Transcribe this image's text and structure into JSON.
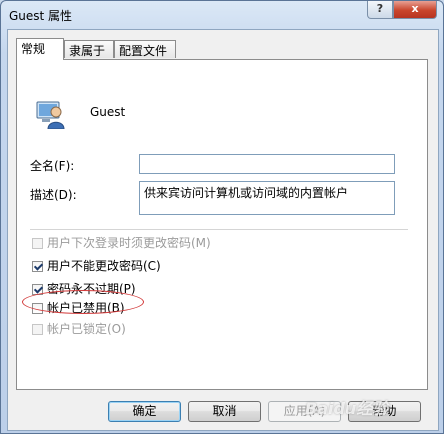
{
  "window": {
    "title": "Guest 属性",
    "help_label": "?",
    "close_label": "x"
  },
  "tabs": [
    {
      "label": "常规",
      "active": true
    },
    {
      "label": "隶属于",
      "active": false
    },
    {
      "label": "配置文件",
      "active": false
    }
  ],
  "user": {
    "name": "Guest",
    "icon": "user-icon"
  },
  "fields": {
    "fullname_label": "全名(F):",
    "fullname_value": "",
    "description_label": "描述(D):",
    "description_value": "供来宾访问计算机或访问域的内置帐户"
  },
  "checkboxes": [
    {
      "label": "用户下次登录时须更改密码(M)",
      "checked": false,
      "enabled": false
    },
    {
      "label": "用户不能更改密码(C)",
      "checked": true,
      "enabled": true
    },
    {
      "label": "密码永不过期(P)",
      "checked": true,
      "enabled": true
    },
    {
      "label": "帐户已禁用(B)",
      "checked": false,
      "enabled": true
    },
    {
      "label": "帐户已锁定(O)",
      "checked": false,
      "enabled": false
    }
  ],
  "buttons": {
    "ok": "确定",
    "cancel": "取消",
    "apply": "应用(A)",
    "help": "帮助"
  },
  "watermark": "Baidu经验",
  "colors": {
    "highlight_ellipse": "#d23a3a",
    "close_button": "#c9452c"
  }
}
